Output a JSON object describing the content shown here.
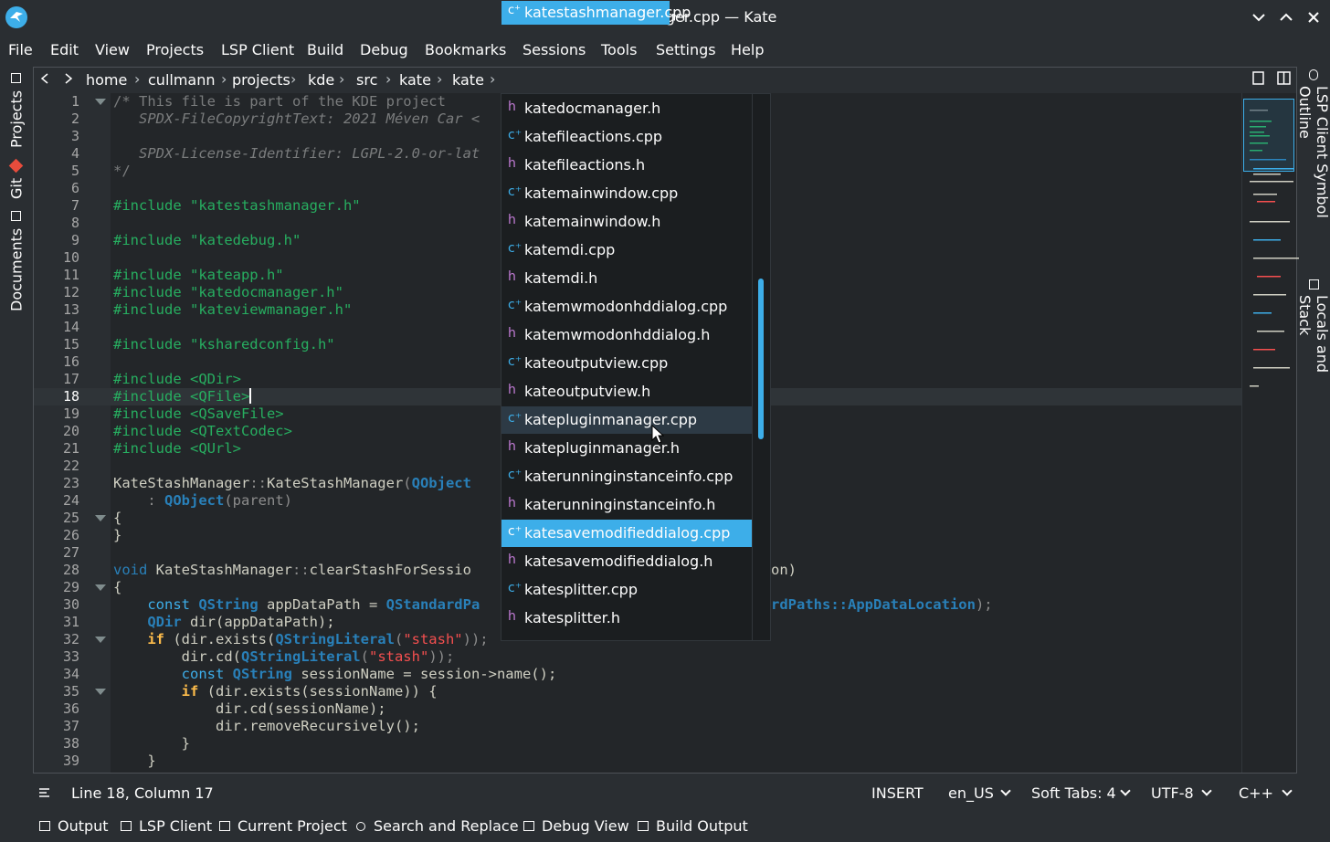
{
  "window": {
    "title": "katestashmanager.cpp — Kate"
  },
  "menubar": [
    "File",
    "Edit",
    "View",
    "Projects",
    "LSP Client",
    "Build",
    "Debug",
    "Bookmarks",
    "Sessions",
    "Tools",
    "Settings",
    "Help"
  ],
  "left_sidebar": {
    "tabs": [
      "Projects",
      "Git",
      "Documents"
    ]
  },
  "right_sidebar": {
    "tabs": [
      "LSP Client Symbol Outline",
      "Locals and Stack"
    ]
  },
  "breadcrumb": {
    "items": [
      "home",
      "cullmann",
      "projects",
      "kde",
      "src",
      "kate",
      "kate"
    ],
    "active": "katestashmanager.cpp"
  },
  "editor": {
    "current_line": 18,
    "line_numbers": [
      "1",
      "2",
      "3",
      "4",
      "5",
      "6",
      "7",
      "8",
      "9",
      "10",
      "11",
      "12",
      "13",
      "14",
      "15",
      "16",
      "17",
      "18",
      "19",
      "20",
      "21",
      "22",
      "23",
      "24",
      "25",
      "26",
      "27",
      "28",
      "29",
      "30",
      "31",
      "32",
      "33",
      "34",
      "35",
      "36",
      "37",
      "38",
      "39"
    ],
    "lines": {
      "l1": "/* This file is part of the KDE project",
      "l2": "   SPDX-FileCopyrightText: 2021 Méven Car <",
      "l4": "   SPDX-License-Identifier: LGPL-2.0-or-lat",
      "l5": "*/",
      "l7": "#include \"katestashmanager.h\"",
      "l9": "#include \"katedebug.h\"",
      "l11": "#include \"kateapp.h\"",
      "l12": "#include \"katedocmanager.h\"",
      "l13": "#include \"kateviewmanager.h\"",
      "l15": "#include \"ksharedconfig.h\"",
      "l17": "#include <QDir>",
      "l18": "#include <QFile>",
      "l19": "#include <QSaveFile>",
      "l20": "#include <QTextCodec>",
      "l21": "#include <QUrl>",
      "l23a": "KateStashManager",
      "l23b": "::",
      "l23c": "KateStashManager",
      "l23d": "(",
      "l23e": "QObject",
      "l24a": "    : ",
      "l24b": "QObject",
      "l24c": "(parent)",
      "l25": "{",
      "l26": "}",
      "l28a": "void ",
      "l28b": "KateStashManager",
      "l28c": "::",
      "l28d": "clearStashForSessio",
      "l28e": "on)",
      "l29": "{",
      "l30a": "    const ",
      "l30b": "QString",
      "l30c": " appDataPath = ",
      "l30d": "QStandardPa",
      "l30e": "rdPaths::AppDataLocation",
      "l30f": ");",
      "l31a": "    ",
      "l31b": "QDir",
      "l31c": " dir(appDataPath);",
      "l32a": "    if ",
      "l32b": "(dir.exists(",
      "l32c": "QStringLiteral",
      "l32d": "(",
      "l32e": "\"stash\"",
      "l32f": "));",
      "l33a": "        dir.cd(",
      "l33b": "QStringLiteral",
      "l33c": "(",
      "l33d": "\"stash\"",
      "l33e": "));",
      "l34a": "        const ",
      "l34b": "QString",
      "l34c": " sessionName = session->name();",
      "l35a": "        if ",
      "l35b": "(dir.exists(sessionName)) {",
      "l36": "            dir.cd(sessionName);",
      "l37": "            dir.removeRecursively();",
      "l38": "        }",
      "l39": "    }"
    }
  },
  "dropdown": {
    "items": [
      {
        "label": "katedocmanager.h",
        "kind": "h"
      },
      {
        "label": "katefileactions.cpp",
        "kind": "cpp"
      },
      {
        "label": "katefileactions.h",
        "kind": "h"
      },
      {
        "label": "katemainwindow.cpp",
        "kind": "cpp"
      },
      {
        "label": "katemainwindow.h",
        "kind": "h"
      },
      {
        "label": "katemdi.cpp",
        "kind": "cpp"
      },
      {
        "label": "katemdi.h",
        "kind": "h"
      },
      {
        "label": "katemwmodonhddialog.cpp",
        "kind": "cpp"
      },
      {
        "label": "katemwmodonhddialog.h",
        "kind": "h"
      },
      {
        "label": "kateoutputview.cpp",
        "kind": "cpp"
      },
      {
        "label": "kateoutputview.h",
        "kind": "h"
      },
      {
        "label": "katepluginmanager.cpp",
        "kind": "cpp"
      },
      {
        "label": "katepluginmanager.h",
        "kind": "h"
      },
      {
        "label": "katerunninginstanceinfo.cpp",
        "kind": "cpp"
      },
      {
        "label": "katerunninginstanceinfo.h",
        "kind": "h"
      },
      {
        "label": "katesavemodifieddialog.cpp",
        "kind": "cpp"
      },
      {
        "label": "katesavemodifieddialog.h",
        "kind": "h"
      },
      {
        "label": "katesplitter.cpp",
        "kind": "cpp"
      },
      {
        "label": "katesplitter.h",
        "kind": "h"
      }
    ],
    "hovered": "katepluginmanager.cpp",
    "selected": "katesavemodifieddialog.cpp"
  },
  "statusbar": {
    "position": "Line 18, Column 17",
    "mode": "INSERT",
    "dictionary": "en_US",
    "indent": "Soft Tabs: 4",
    "encoding": "UTF-8",
    "language": "C++"
  },
  "bottom_tabs": [
    "Output",
    "LSP Client",
    "Current Project",
    "Search and Replace",
    "Debug View",
    "Build Output"
  ],
  "colors": {
    "accent": "#3daee9",
    "background": "#2a2e32",
    "editor_background": "#232629",
    "preprocessor": "#27ae60",
    "string": "#f44f4f"
  }
}
